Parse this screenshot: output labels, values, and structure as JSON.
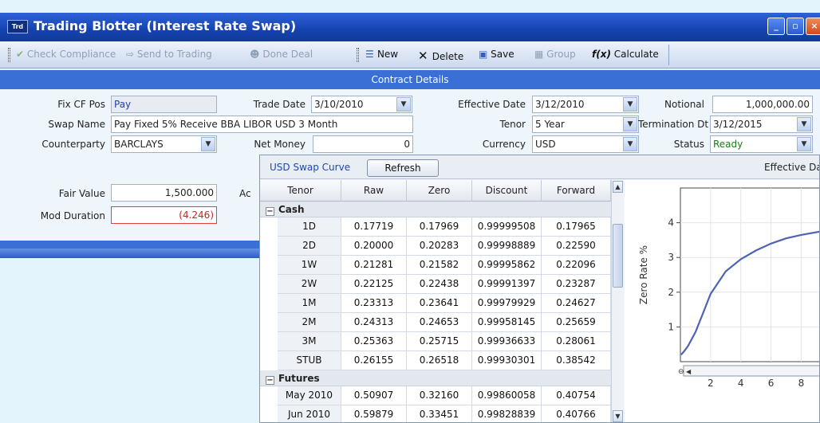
{
  "window": {
    "title": "Trading Blotter (Interest Rate Swap)",
    "icon_text": "Trd"
  },
  "toolbar": {
    "check_compliance": "Check Compliance",
    "send_to_trading": "Send to Trading",
    "done_deal": "Done Deal",
    "new": "New",
    "delete": "Delete",
    "save": "Save",
    "group": "Group",
    "fx": "f(x)",
    "calculate": "Calculate"
  },
  "section_header": "Contract Details",
  "contract": {
    "fix_cf_pos_label": "Fix CF Pos",
    "fix_cf_pos": "Pay",
    "trade_date_label": "Trade Date",
    "trade_date": "3/10/2010",
    "effective_date_label": "Effective Date",
    "effective_date": "3/12/2010",
    "notional_label": "Notional",
    "notional": "1,000,000.00",
    "swap_name_label": "Swap Name",
    "swap_name": "Pay Fixed 5% Receive BBA LIBOR USD 3 Month",
    "tenor_label": "Tenor",
    "tenor": "5 Year",
    "termination_label": "Termination Dt",
    "termination": "3/12/2015",
    "counterparty_label": "Counterparty",
    "counterparty": "BARCLAYS",
    "net_money_label": "Net Money",
    "net_money": "0",
    "currency_label": "Currency",
    "currency": "USD",
    "status_label": "Status",
    "status": "Ready",
    "fair_value_label": "Fair Value",
    "fair_value": "1,500.000",
    "ac_label": "Ac",
    "mod_duration_label": "Mod Duration",
    "mod_duration": "(4.246)"
  },
  "curve": {
    "title": "USD Swap Curve",
    "refresh": "Refresh",
    "effective_partial": "Effective Da",
    "columns": [
      "Tenor",
      "Raw",
      "Zero",
      "Discount",
      "Forward"
    ],
    "groups": [
      {
        "name": "Cash",
        "rows": [
          [
            "1D",
            "0.17719",
            "0.17969",
            "0.99999508",
            "0.17965"
          ],
          [
            "2D",
            "0.20000",
            "0.20283",
            "0.99998889",
            "0.22590"
          ],
          [
            "1W",
            "0.21281",
            "0.21582",
            "0.99995862",
            "0.22096"
          ],
          [
            "2W",
            "0.22125",
            "0.22438",
            "0.99991397",
            "0.23287"
          ],
          [
            "1M",
            "0.23313",
            "0.23641",
            "0.99979929",
            "0.24627"
          ],
          [
            "2M",
            "0.24313",
            "0.24653",
            "0.99958145",
            "0.25659"
          ],
          [
            "3M",
            "0.25363",
            "0.25715",
            "0.99936633",
            "0.28061"
          ],
          [
            "STUB",
            "0.26155",
            "0.26518",
            "0.99930301",
            "0.38542"
          ]
        ]
      },
      {
        "name": "Futures",
        "rows": [
          [
            "May 2010",
            "0.50907",
            "0.32160",
            "0.99860058",
            "0.40754"
          ],
          [
            "Jun 2010",
            "0.59879",
            "0.33451",
            "0.99828839",
            "0.40766"
          ]
        ]
      }
    ]
  },
  "chart_data": {
    "type": "line",
    "title": "",
    "xlabel": "",
    "ylabel": "Zero Rate %",
    "xlim": [
      0,
      9.3
    ],
    "ylim": [
      0,
      5
    ],
    "x_ticks": [
      "2",
      "4",
      "6",
      "8"
    ],
    "y_ticks": [
      "1",
      "2",
      "3",
      "4"
    ],
    "series": [
      {
        "x": [
          0.05,
          0.25,
          0.5,
          1,
          1.5,
          2,
          3,
          4,
          5,
          6,
          7,
          8,
          9.3
        ],
        "y": [
          0.2,
          0.3,
          0.45,
          0.85,
          1.4,
          1.95,
          2.6,
          2.95,
          3.2,
          3.4,
          3.55,
          3.65,
          3.75
        ]
      }
    ],
    "grid": true,
    "color": "#4f63b4"
  }
}
